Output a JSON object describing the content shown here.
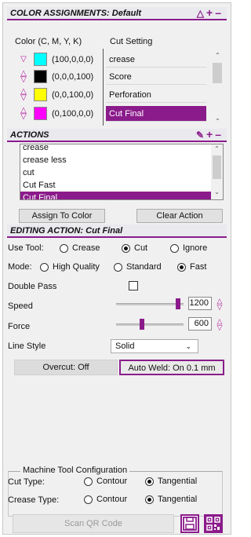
{
  "color_assignments": {
    "header": "COLOR ASSIGNMENTS: Default",
    "col_color": "Color (C, M, Y, K)",
    "col_setting": "Cut Setting",
    "rows": [
      {
        "cmyk": "(100,0,0,0)",
        "color": "#00ffff",
        "setting": "crease",
        "selected": false
      },
      {
        "cmyk": "(0,0,0,100)",
        "color": "#000000",
        "setting": "Score",
        "selected": false
      },
      {
        "cmyk": "(0,0,100,0)",
        "color": "#ffff00",
        "setting": "Perforation",
        "selected": false
      },
      {
        "cmyk": "(0,100,0,0)",
        "color": "#ff00ff",
        "setting": "Cut Final",
        "selected": true
      }
    ]
  },
  "actions": {
    "header": "ACTIONS",
    "items": [
      "crease",
      "crease less",
      "cut",
      "Cut Fast",
      "Cut Final"
    ],
    "selected": "Cut Final",
    "assign_button": "Assign To Color",
    "clear_button": "Clear Action"
  },
  "editing": {
    "header": "EDITING ACTION: Cut Final",
    "use_tool_label": "Use Tool:",
    "use_tool_options": [
      "Crease",
      "Cut",
      "Ignore"
    ],
    "use_tool_selected": "Cut",
    "mode_label": "Mode:",
    "mode_options": [
      "High Quality",
      "Standard",
      "Fast"
    ],
    "mode_selected": "Fast",
    "double_pass_label": "Double Pass",
    "double_pass": false,
    "speed_label": "Speed",
    "speed_value": "1200",
    "speed_fraction": 0.95,
    "force_label": "Force",
    "force_value": "600",
    "force_fraction": 0.37,
    "line_style_label": "Line Style",
    "line_style_value": "Solid",
    "overcut": "Overcut: Off",
    "auto_weld": "Auto Weld: On 0.1 mm"
  },
  "machine": {
    "title": "Machine Tool Configuration",
    "cut_type_label": "Cut Type:",
    "crease_type_label": "Crease Type:",
    "options": [
      "Contour",
      "Tangential"
    ],
    "cut_type_selected": "Tangential",
    "crease_type_selected": "Tangential"
  },
  "bottom": {
    "scan_button": "Scan QR Code"
  },
  "colors": {
    "accent": "#8b1b8b",
    "arrow": "#b0179b"
  }
}
